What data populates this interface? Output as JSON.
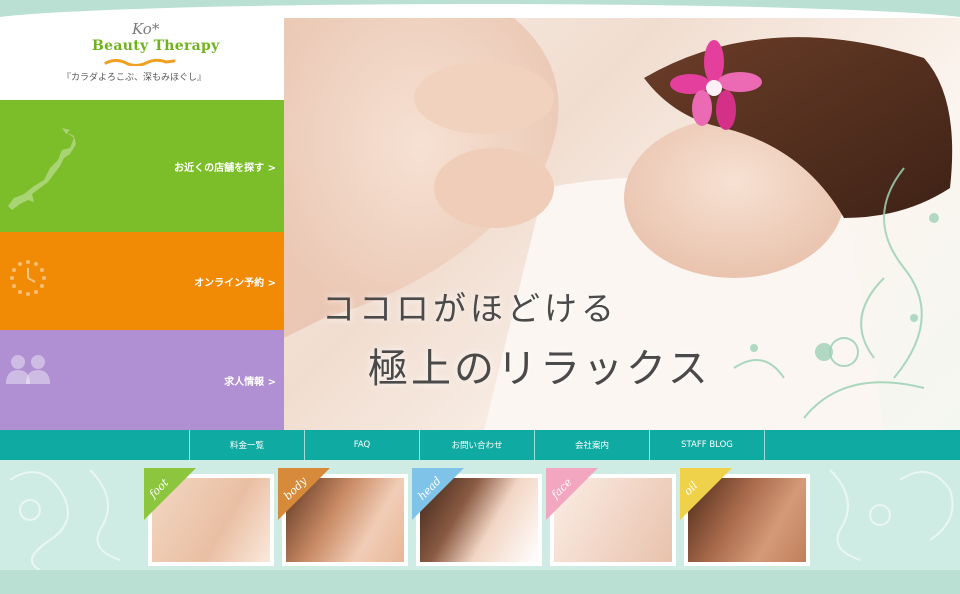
{
  "logo": {
    "mark": "Ko*",
    "title": "Beauty Therapy",
    "tagline": "『カラダよろこぶ、深もみほぐし』"
  },
  "left_nav": [
    {
      "label": "お近くの店舗を探す >",
      "color": "#7cbd2a",
      "icon": "japan-map-icon"
    },
    {
      "label": "オンライン予約 >",
      "color": "#f18b06",
      "icon": "clock-icon"
    },
    {
      "label": "求人情報 >",
      "color": "#b08fd2",
      "icon": "people-icon"
    }
  ],
  "hero": {
    "line1": "ココロがほどける",
    "line2": "極上のリラックス"
  },
  "menu": [
    {
      "label": "料金一覧"
    },
    {
      "label": "FAQ"
    },
    {
      "label": "お問い合わせ"
    },
    {
      "label": "会社案内"
    },
    {
      "label": "STAFF BLOG"
    }
  ],
  "categories": [
    {
      "label": "foot",
      "ribbon_color": "#8cc63f"
    },
    {
      "label": "body",
      "ribbon_color": "#d68a3a"
    },
    {
      "label": "head",
      "ribbon_color": "#7fc3e8"
    },
    {
      "label": "face",
      "ribbon_color": "#f2a6c0"
    },
    {
      "label": "oil",
      "ribbon_color": "#f0d24a"
    }
  ],
  "colors": {
    "accent_teal": "#0faaa2",
    "mint_background": "#b9e0d3"
  }
}
